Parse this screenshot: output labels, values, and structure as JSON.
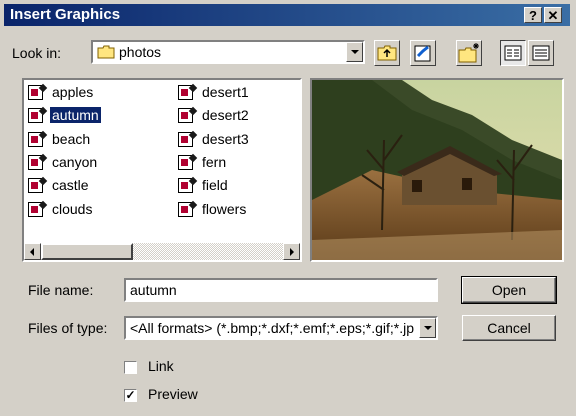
{
  "window": {
    "title": "Insert Graphics",
    "help_label": "?",
    "close_label": "✕"
  },
  "look_in": {
    "label": "Look in:",
    "value": "photos",
    "icon": "folder-icon"
  },
  "toolbar": {
    "up": "up-folder-icon",
    "favorites": "favorites-icon",
    "new_folder": "new-folder-icon",
    "list_view": "list-view-icon",
    "details_view": "details-view-icon"
  },
  "files": {
    "column1": [
      "apples",
      "autumn",
      "beach",
      "canyon",
      "castle",
      "clouds"
    ],
    "column2": [
      "desert1",
      "desert2",
      "desert3",
      "fern",
      "field",
      "flowers"
    ],
    "selected": "autumn"
  },
  "file_name": {
    "label": "File name:",
    "value": "autumn"
  },
  "files_of_type": {
    "label": "Files of type:",
    "value": "<All formats> (*.bmp;*.dxf;*.emf;*.eps;*.gif;*.jp"
  },
  "buttons": {
    "open": "Open",
    "cancel": "Cancel"
  },
  "options": {
    "link_label": "Link",
    "link_checked": false,
    "preview_label": "Preview",
    "preview_checked": true,
    "preview_mark": "✓"
  }
}
